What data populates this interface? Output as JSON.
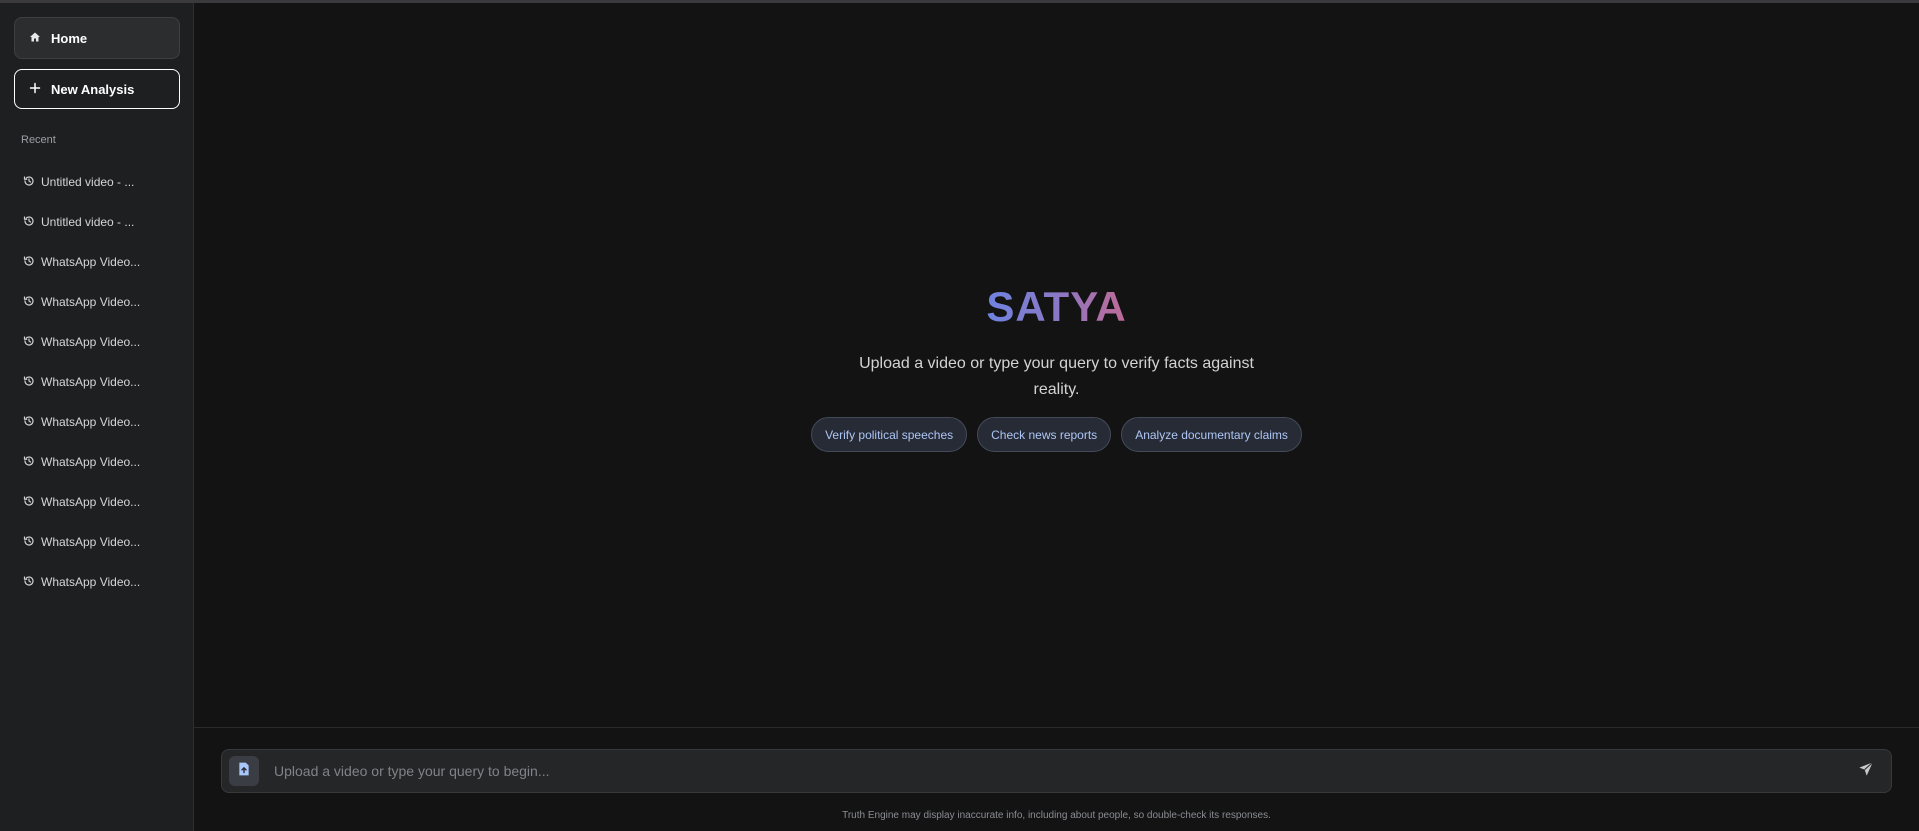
{
  "sidebar": {
    "home_label": "Home",
    "new_analysis_label": "New Analysis",
    "recent_label": "Recent",
    "recent_items": [
      {
        "label": "Untitled video - ..."
      },
      {
        "label": "Untitled video - ..."
      },
      {
        "label": "WhatsApp Video..."
      },
      {
        "label": "WhatsApp Video..."
      },
      {
        "label": "WhatsApp Video..."
      },
      {
        "label": "WhatsApp Video..."
      },
      {
        "label": "WhatsApp Video..."
      },
      {
        "label": "WhatsApp Video..."
      },
      {
        "label": "WhatsApp Video..."
      },
      {
        "label": "WhatsApp Video..."
      },
      {
        "label": "WhatsApp Video..."
      }
    ]
  },
  "hero": {
    "brand": "SATYA",
    "tagline": "Upload a video or type your query to verify facts against reality.",
    "suggestions": [
      {
        "label": "Verify political speeches"
      },
      {
        "label": "Check news reports"
      },
      {
        "label": "Analyze documentary claims"
      }
    ]
  },
  "composer": {
    "placeholder": "Upload a video or type your query to begin...",
    "value": "",
    "disclaimer": "Truth Engine may display inaccurate info, including about people, so double-check its responses."
  },
  "icons": {
    "home": "home-icon",
    "new": "plus-icon",
    "history": "history-icon",
    "attach": "file-upload-icon",
    "send": "send-icon"
  },
  "colors": {
    "background": "#131314",
    "sidebar": "#1e1f20",
    "chip_text": "#aec6f5",
    "brand_gradient_start": "#6f83e0",
    "brand_gradient_end": "#c06a95"
  }
}
